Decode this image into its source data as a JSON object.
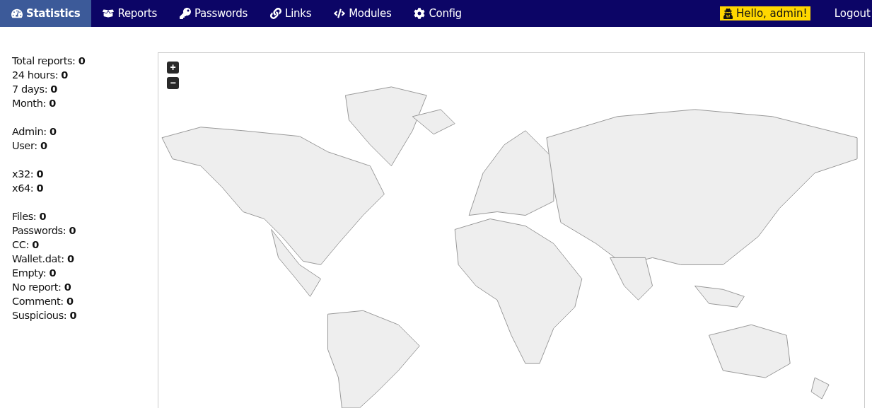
{
  "nav": {
    "items": [
      {
        "label": "Statistics",
        "selected": true
      },
      {
        "label": "Reports",
        "selected": false
      },
      {
        "label": "Passwords",
        "selected": false
      },
      {
        "label": "Links",
        "selected": false
      },
      {
        "label": "Modules",
        "selected": false
      },
      {
        "label": "Config",
        "selected": false
      }
    ],
    "greeting": "Hello, admin!",
    "logout": "Logout"
  },
  "stats": [
    [
      {
        "text": "Total reports: **0**"
      },
      {
        "text": "24 hours: **0**"
      },
      {
        "text": "7 days: **0**"
      },
      {
        "text": "Month: **0**"
      }
    ],
    [
      {
        "text": "Admin: **0**"
      },
      {
        "text": "User: **0**"
      }
    ],
    [
      {
        "text": "x32: **0**"
      },
      {
        "text": "x64: **0**"
      }
    ],
    [
      {
        "text": "Files: **0**"
      },
      {
        "text": "Passwords: **0**"
      },
      {
        "text": "CC: **0**"
      },
      {
        "text": "Wallet.dat: **0**"
      },
      {
        "text": "Empty: **0**"
      },
      {
        "text": "No report: **0**"
      },
      {
        "text": "Comment: **0**"
      },
      {
        "text": "Suspicious: **0**"
      }
    ]
  ],
  "map": {
    "zoom_in": "+",
    "zoom_out": "−"
  }
}
